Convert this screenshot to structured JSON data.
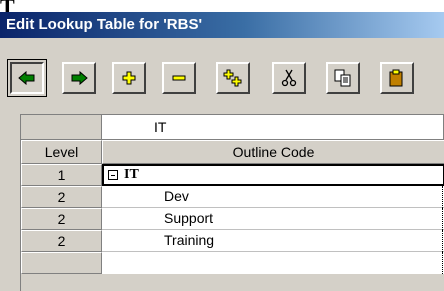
{
  "window": {
    "title": "Edit Lookup Table for 'RBS'"
  },
  "toolbar": {
    "buttons": [
      {
        "name": "outdent",
        "icon": "arrow-left-icon"
      },
      {
        "name": "indent",
        "icon": "arrow-right-icon"
      },
      {
        "name": "expand",
        "icon": "plus-icon"
      },
      {
        "name": "collapse",
        "icon": "minus-icon"
      },
      {
        "name": "show-all",
        "icon": "plus-plus-icon"
      },
      {
        "name": "cut",
        "icon": "scissors-icon"
      },
      {
        "name": "copy",
        "icon": "copy-icon"
      },
      {
        "name": "paste",
        "icon": "paste-icon"
      }
    ]
  },
  "edit": {
    "value": "IT"
  },
  "grid": {
    "headers": {
      "level": "Level",
      "code": "Outline Code"
    },
    "rows": [
      {
        "level": "1",
        "code": "IT"
      },
      {
        "level": "2",
        "code": "Dev"
      },
      {
        "level": "2",
        "code": "Support"
      },
      {
        "level": "2",
        "code": "Training"
      }
    ]
  },
  "colors": {
    "accent": "#0a246a",
    "face": "#d4d0c8",
    "icon_green": "#008000",
    "icon_yellow": "#ffff00"
  }
}
